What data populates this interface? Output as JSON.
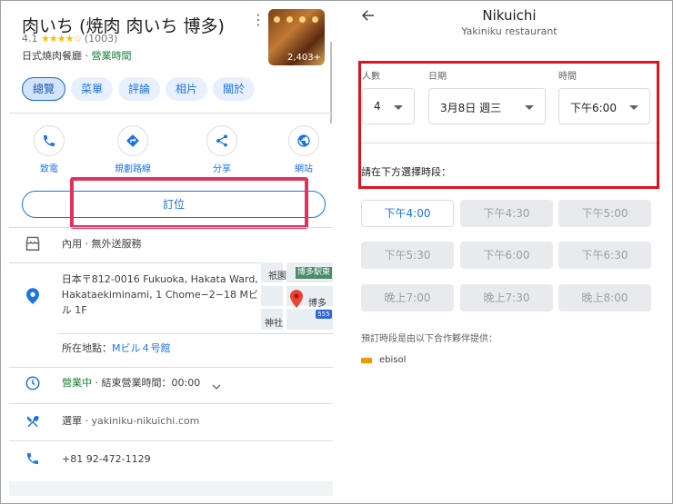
{
  "left": {
    "title": "肉いち (焼肉 肉いち 博多)",
    "rating_value": "4.1",
    "stars": "★★★★☆",
    "review_count": "(1003)",
    "category": "日式燒肉餐廳",
    "separator": " · ",
    "open_status": "營業時間",
    "photo_count": "2,403+",
    "tabs": [
      "總覽",
      "菜單",
      "評論",
      "相片",
      "關於"
    ],
    "actions": [
      {
        "label": "致電",
        "icon": "phone-icon"
      },
      {
        "label": "規劃路線",
        "icon": "directions-icon"
      },
      {
        "label": "分享",
        "icon": "share-icon"
      },
      {
        "label": "網站",
        "icon": "globe-icon"
      }
    ],
    "book_label": "訂位",
    "service_options": "內用 · 無外送服務",
    "address": "日本〒812-0016 Fukuoka, Hakata Ward, Hakataekiminami, 1 Chome−2−18 Mビル 1F",
    "located_in_label": "所在地點：",
    "located_in_value": "Mビル４号館",
    "hours_open": "營業中",
    "hours_rest": " · 結束營業時間：00:00",
    "menu_label": "選單 · ",
    "menu_url": "yakiniku-nikuichi.com",
    "phone": "+81 92-472-1129",
    "map": {
      "label_top": "祇園",
      "rail_tag": "博多駅東",
      "label_right": "博多",
      "label_bottom": "神社",
      "road_number": "555"
    }
  },
  "right": {
    "title": "Nikuichi",
    "subtitle": "Yakiniku restaurant",
    "party_label": "人數",
    "party_value": "4",
    "date_label": "日期",
    "date_value": "3月8日 週三",
    "time_label": "時間",
    "time_value": "下午6:00",
    "hint": "請在下方選擇時段：",
    "slots": [
      "下午4:00",
      "下午4:30",
      "下午5:00",
      "下午5:30",
      "下午6:00",
      "下午6:30",
      "晚上7:00",
      "晚上7:30",
      "晚上8:00"
    ],
    "provided_by": "預訂時段是由以下合作夥伴提供：",
    "partner_name": "ebisol"
  },
  "colors": {
    "accent": "#1a73e8",
    "highlight_left": "#e0335a",
    "highlight_right": "#e0121c",
    "open_green": "#188038"
  }
}
